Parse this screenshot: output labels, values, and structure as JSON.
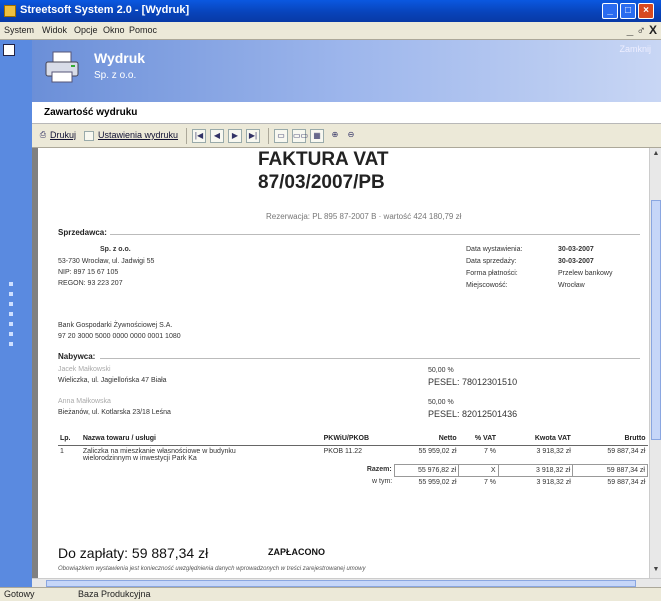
{
  "window": {
    "title": "Streetsoft System 2.0 - [Wydruk]"
  },
  "menubar": {
    "items": [
      "System",
      "Widok",
      "Opcje",
      "Okno",
      "Pomoc"
    ],
    "mdi_controls": "_ ♂ X"
  },
  "header": {
    "title": "Wydruk",
    "subtitle": "Sp. z o.o.",
    "right_text": "Zamknij"
  },
  "section": {
    "title": "Zawartość wydruku"
  },
  "toolbar": {
    "print_label": "Drukuj",
    "settings_label": "Ustawienia wydruku"
  },
  "invoice": {
    "title": "FAKTURA VAT",
    "number": "87/03/2007/PB",
    "fineprint": "Rezerwacja: PL 895 87-2007 B · wartość 424 180,79 zł",
    "seller": {
      "label": "Sprzedawca:",
      "name": "Sp. z o.o.",
      "address": "53-730 Wrocław, ul. Jadwigi 55",
      "nip": "NIP: 897 15 67 105",
      "regon": "REGON: 93 223 207",
      "bank": "Bank Gospodarki Żywnościowej S.A.",
      "account": "97 20 3000 5000 0000 0000 0001 1080"
    },
    "meta": {
      "issue_date_label": "Data wystawienia:",
      "issue_date": "30-03-2007",
      "sale_date_label": "Data sprzedaży:",
      "sale_date": "30-03-2007",
      "payment_label": "Forma płatności:",
      "payment": "Przelew bankowy",
      "place_label": "Miejscowość:",
      "place": "Wrocław"
    },
    "buyer": {
      "label": "Nabywca:",
      "entries": [
        {
          "name": "Jacek Małkowski",
          "address": "Wieliczka, ul. Jagiellońska 47 Biała",
          "share": "50,00 %",
          "pesel": "PESEL: 78012301510"
        },
        {
          "name": "Anna Małkowska",
          "address": "Bieżanów, ul. Kotlarska 23/18 Leśna",
          "share": "50,00 %",
          "pesel": "PESEL: 82012501436"
        }
      ]
    },
    "items_table": {
      "headers": [
        "Lp.",
        "Nazwa towaru / usługi",
        "PKWiU/PKOB",
        "Netto",
        "% VAT",
        "Kwota VAT",
        "Brutto"
      ],
      "rows": [
        {
          "lp": "1",
          "name_line1": "Zaliczka na mieszkanie własnościowe w budynku",
          "name_line2": "wielorodzinnym w inwestycji Park Ka",
          "pkwiu": "PKOB 11.22",
          "netto": "55 959,02 zł",
          "vat_pct": "7 %",
          "vat_amount": "3 918,32 zł",
          "brutto": "59 887,34 zł"
        }
      ],
      "total": {
        "label": "Razem:",
        "netto": "55 976,82 zł",
        "vat_pct": "X",
        "vat_amount": "3 918,32 zł",
        "brutto": "59 887,34 zł"
      },
      "of_which": {
        "label": "w tym:",
        "netto": "55 959,02 zł",
        "vat_pct": "7 %",
        "vat_amount": "3 918,32 zł",
        "brutto": "59 887,34 zł"
      }
    },
    "due_label": "Do zapłaty: 59 887,34 zł",
    "paid_label": "ZAPŁACONO",
    "note": "Obowiązkiem wystawienia jest konieczność uwzględnienia danych wprowadzonych w treści zarejestrowanej umowy"
  },
  "status": {
    "left": "Gotowy",
    "right": "Baza Produkcyjna"
  },
  "colors": {
    "titlebar": "#0842b8",
    "header_gradient_start": "#6b8fd8",
    "left_strip": "#5a8ae0"
  }
}
